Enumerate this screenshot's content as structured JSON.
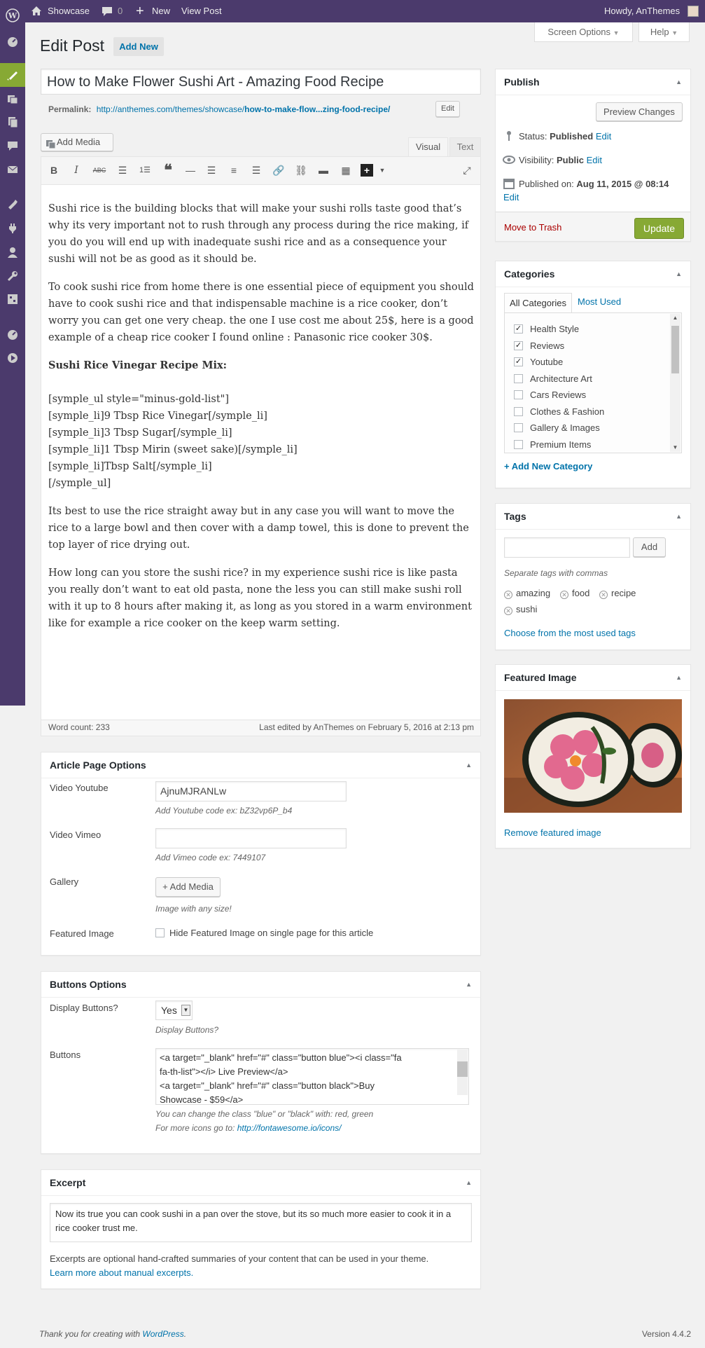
{
  "admin_bar": {
    "site_name": "Showcase",
    "comments_count": "0",
    "new_label": "New",
    "view_post": "View Post",
    "greeting": "Howdy, AnThemes"
  },
  "screen_meta": {
    "screen_options": "Screen Options",
    "help": "Help"
  },
  "page": {
    "title": "Edit Post",
    "add_new": "Add New"
  },
  "post": {
    "title": "How to Make Flower Sushi Art - Amazing Food Recipe",
    "permalink_label": "Permalink:",
    "permalink_base": "http://anthemes.com/themes/showcase/",
    "permalink_slug": "how-to-make-flow...zing-food-recipe/",
    "permalink_edit": "Edit"
  },
  "editor": {
    "add_media": "Add Media",
    "tab_visual": "Visual",
    "tab_text": "Text",
    "content": {
      "p1": "Sushi rice is the building blocks that will make your sushi rolls taste good that’s why its very important not to rush through any process during the rice making, if you do you will end up with inadequate sushi rice and as a consequence your sushi will not be as good as it should be.",
      "p2": "To cook sushi rice from home there is one essential piece of equipment you should have to cook sushi rice and that indispensable machine is a rice cooker, don’t worry you can get one very cheap. the one I use cost me about 25$, here is a good example of a cheap rice cooker I found online : Panasonic rice cooker 30$.",
      "heading": "Sushi Rice Vinegar Recipe Mix:",
      "code": [
        "[symple_ul style=\"minus-gold-list\"]",
        "[symple_li]9 Tbsp Rice Vinegar[/symple_li]",
        "[symple_li]3 Tbsp Sugar[/symple_li]",
        "[symple_li]1 Tbsp Mirin (sweet sake)[/symple_li]",
        "[symple_li]Tbsp Salt[/symple_li]",
        "[/symple_ul]"
      ],
      "p3": "Its best to use the rice straight away but in any case you will want to move the rice to a large bowl and then cover with a damp towel, this is done to prevent the top layer of rice drying out.",
      "p4": "How long can you store the sushi rice? in my experience sushi rice is like pasta you really don’t want to eat old pasta, none the less you can still make sushi roll with it up to 8 hours after making it, as long as you stored in a warm environment like for example a rice cooker on the keep warm setting."
    },
    "word_count": "Word count: 233",
    "last_edited": "Last edited by AnThemes on February 5, 2016 at 2:13 pm"
  },
  "article_options": {
    "title": "Article Page Options",
    "video_youtube_label": "Video Youtube",
    "video_youtube_value": "AjnuMJRANLw",
    "video_youtube_hint": "Add Youtube code ex: bZ32vp6P_b4",
    "video_vimeo_label": "Video Vimeo",
    "video_vimeo_value": "",
    "video_vimeo_hint": "Add Vimeo code ex: 7449107",
    "gallery_label": "Gallery",
    "gallery_button": "+ Add Media",
    "gallery_hint": "Image with any size!",
    "featured_label": "Featured Image",
    "featured_checkbox": "Hide Featured Image on single page for this article"
  },
  "buttons_options": {
    "title": "Buttons Options",
    "display_label": "Display Buttons?",
    "display_value": "Yes",
    "display_hint": "Display Buttons?",
    "buttons_label": "Buttons",
    "buttons_lines": [
      "<a target=\"_blank\" href=\"#\" class=\"button blue\"><i class=\"fa",
      "fa-th-list\"></i> Live Preview</a>",
      "<a target=\"_blank\" href=\"#\" class=\"button black\">Buy",
      "Showcase - $59</a>"
    ],
    "hint1": "You can change the class \"blue\" or \"black\" with: red, green",
    "hint2_prefix": "For more icons go to:",
    "hint2_link": "http://fontawesome.io/icons/"
  },
  "excerpt": {
    "title": "Excerpt",
    "text": "Now its true you can cook sushi in a pan over the stove, but its so much more easier to cook it in a rice cooker trust me.",
    "help": "Excerpts are optional hand-crafted summaries of your content that can be used in your theme.",
    "learn_more": "Learn more about manual excerpts."
  },
  "publish": {
    "title": "Publish",
    "preview": "Preview Changes",
    "status_label": "Status:",
    "status_value": "Published",
    "edit": "Edit",
    "visibility_label": "Visibility:",
    "visibility_value": "Public",
    "published_label": "Published on:",
    "published_value": "Aug 11, 2015 @ 08:14",
    "trash": "Move to Trash",
    "update": "Update"
  },
  "categories": {
    "title": "Categories",
    "tab_all": "All Categories",
    "tab_most": "Most Used",
    "items": [
      {
        "label": "Health Style",
        "checked": true
      },
      {
        "label": "Reviews",
        "checked": true
      },
      {
        "label": "Youtube",
        "checked": true
      },
      {
        "label": "Architecture Art",
        "checked": false
      },
      {
        "label": "Cars Reviews",
        "checked": false
      },
      {
        "label": "Clothes & Fashion",
        "checked": false
      },
      {
        "label": "Gallery & Images",
        "checked": false
      },
      {
        "label": "Premium Items",
        "checked": false
      }
    ],
    "add_new": "+ Add New Category"
  },
  "tags": {
    "title": "Tags",
    "add": "Add",
    "hint": "Separate tags with commas",
    "items": [
      "amazing",
      "food",
      "recipe",
      "sushi"
    ],
    "choose": "Choose from the most used tags"
  },
  "featured_image": {
    "title": "Featured Image",
    "remove": "Remove featured image"
  },
  "footer": {
    "thanks_prefix": "Thank you for creating with",
    "wordpress": "WordPress",
    "thanks_suffix": ".",
    "version": "Version 4.4.2"
  },
  "colors": {
    "admin_bar": "#4b3a6c",
    "menu_current": "#87a934",
    "update_button": "#87a934",
    "link": "#0073aa",
    "trash": "#a00"
  }
}
